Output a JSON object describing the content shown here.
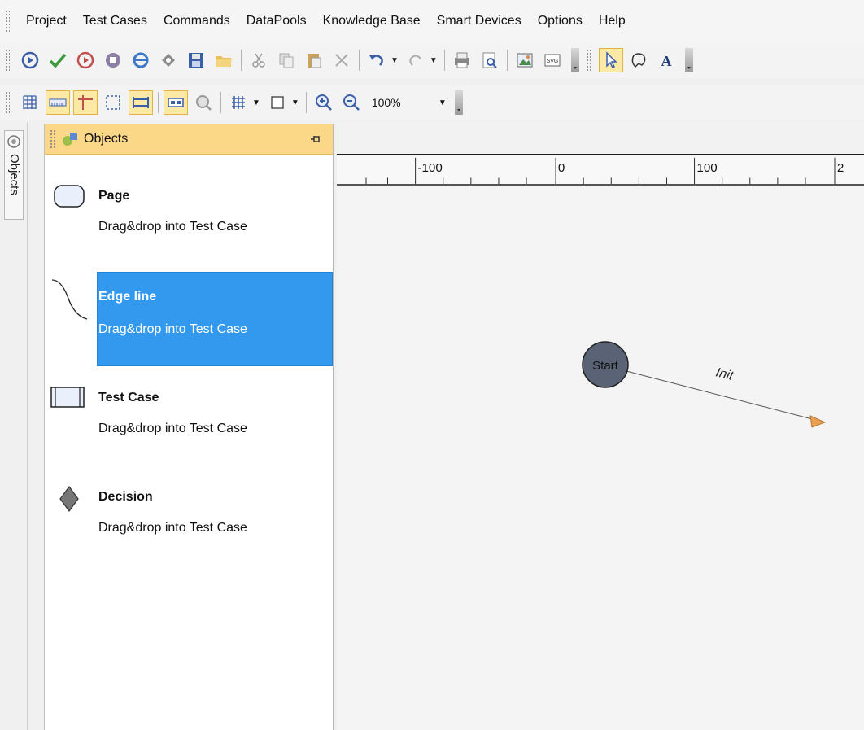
{
  "menu": [
    "Project",
    "Test Cases",
    "Commands",
    "DataPools",
    "Knowledge Base",
    "Smart Devices",
    "Options",
    "Help"
  ],
  "toolbar2": {
    "zoom": "100%"
  },
  "sidetab": {
    "label": "Objects"
  },
  "objects_panel": {
    "title": "Objects",
    "items": [
      {
        "title": "Page",
        "description": "Drag&drop into Test Case",
        "icon": "page-shape-icon"
      },
      {
        "title": "Edge line",
        "description": "Drag&drop into Test Case",
        "icon": "edge-line-icon",
        "selected": true
      },
      {
        "title": "Test Case",
        "description": "Drag&drop into Test Case",
        "icon": "test-case-shape-icon"
      },
      {
        "title": "Decision",
        "description": "Drag&drop into Test Case",
        "icon": "diamond-icon"
      }
    ]
  },
  "ruler": {
    "labels": [
      "-100",
      "0",
      "100",
      "2"
    ]
  },
  "diagram": {
    "start_node": "Start",
    "edge_label": "Init"
  },
  "colors": {
    "selection": "#3399ee",
    "panel_header": "#fbd788",
    "start_node": "#5a6275",
    "edge_arrow": "#e8a050"
  }
}
